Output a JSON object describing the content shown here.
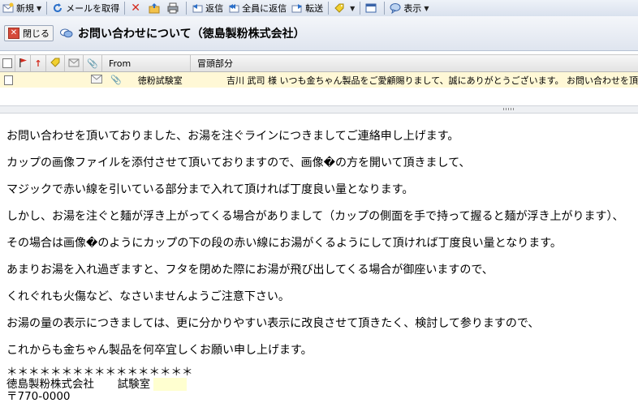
{
  "toolbar": {
    "new_label": "新規",
    "fetch_label": "メールを取得",
    "reply_label": "返信",
    "reply_all_label": "全員に返信",
    "forward_label": "転送",
    "view_label": "表示"
  },
  "titlebar": {
    "close_label": "閉じる",
    "subject": "お問い合わせについて（徳島製粉株式会社）"
  },
  "list_header": {
    "from": "From",
    "preview": "冒頭部分"
  },
  "message_row": {
    "from": "徳粉試験室",
    "preview": "吉川 武司 様 いつも金ちゃん製品をご愛顧賜りまして、誠にありがとうございます。 お問い合わせを頂"
  },
  "body_lines": [
    "お問い合わせを頂いておりました、お湯を注ぐラインにつきましてご連絡申し上げます。",
    "カップの画像ファイルを添付させて頂いておりますので、画像�の方を開いて頂きまして、",
    "マジックで赤い線を引いている部分まで入れて頂ければ丁度良い量となります。",
    "しかし、お湯を注ぐと麺が浮き上がってくる場合がありまして（カップの側面を手で持って握ると麺が浮き上がります）、",
    "その場合は画像�のようにカップの下の段の赤い線にお湯がくるようにして頂ければ丁度良い量となります。",
    "あまりお湯を入れ過ぎますと、フタを閉めた際にお湯が飛び出してくる場合が御座いますので、",
    "くれぐれも火傷など、なさいませんようご注意下さい。",
    "お湯の量の表示につきましては、更に分かりやすい表示に改良させて頂きたく、検討して参りますので、",
    "これからも金ちゃん製品を何卒宜しくお願い申し上げます。"
  ],
  "signature": {
    "stars": "＊＊＊＊＊＊＊＊＊＊＊＊＊＊＊＊＊",
    "company": "徳島製粉株式会社",
    "dept": "試験室",
    "postal": "〒770-0000"
  },
  "colors": {
    "row_highlight": "#fff8d6",
    "toolbar_bg": "#dfe5ef"
  }
}
